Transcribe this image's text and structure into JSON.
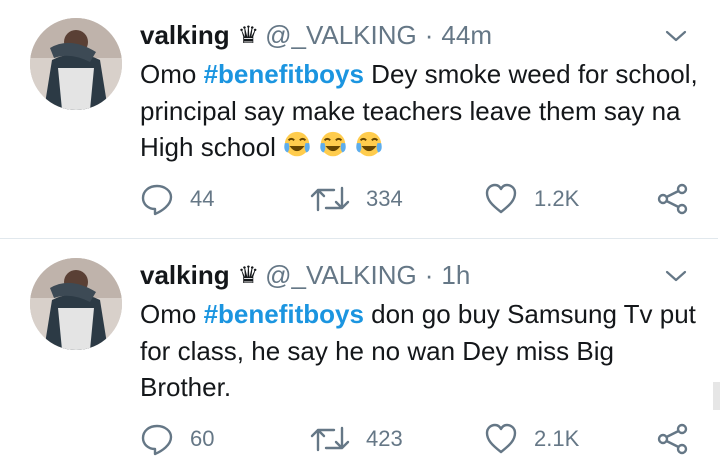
{
  "tweets": [
    {
      "name": "valking",
      "badge": "♛",
      "handle": "@_VALKING",
      "separator": "·",
      "time": "44m",
      "text_before": "Omo ",
      "hashtag": "#benefitboys",
      "text_after": " Dey smoke weed for school, principal say make teachers leave them say na High school",
      "emoji": [
        "face-with-tears-of-joy",
        "face-with-tears-of-joy",
        "face-with-tears-of-joy"
      ],
      "replies": "44",
      "retweets": "334",
      "likes": "1.2K"
    },
    {
      "name": "valking",
      "badge": "♛",
      "handle": "@_VALKING",
      "separator": "·",
      "time": "1h",
      "text_before": "Omo ",
      "hashtag": "#benefitboys",
      "text_after": " don go buy Samsung Tv put for class, he say he no wan Dey miss Big Brother.",
      "emoji": [],
      "replies": "60",
      "retweets": "423",
      "likes": "2.1K"
    }
  ],
  "colors": {
    "hashtag": "#1b95e0",
    "muted": "#657786",
    "text": "#14171a",
    "divider": "#e1e8ed"
  },
  "icons": [
    "reply-icon",
    "retweet-icon",
    "like-icon",
    "share-icon",
    "chevron-down-icon"
  ]
}
